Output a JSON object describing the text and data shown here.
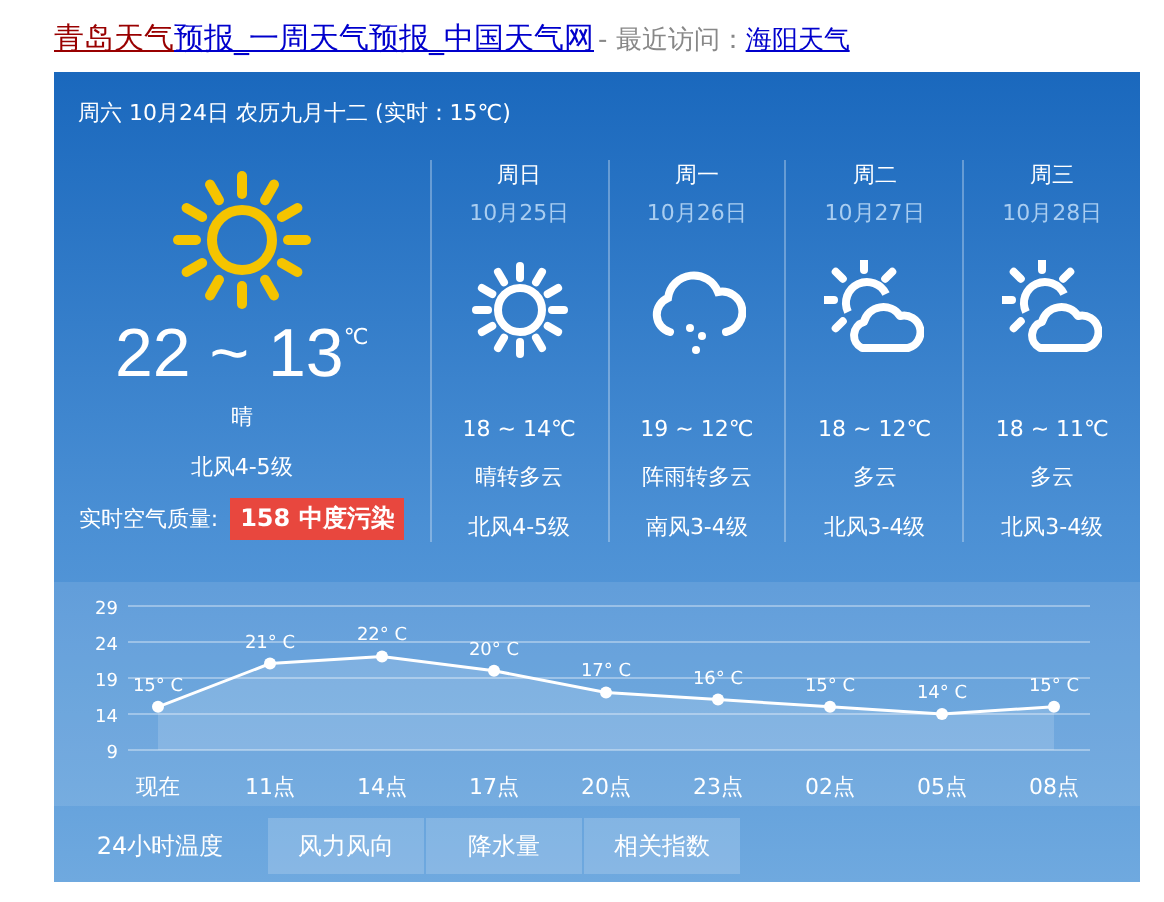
{
  "page_title": {
    "links": [
      {
        "text": "青岛天气",
        "visited": true
      },
      {
        "text": "预报_一周天气预报_中国天气网",
        "visited": false
      }
    ],
    "recent_label": " - 最近访问：",
    "recent_link": "海阳天气"
  },
  "header": "周六 10月24日 农历九月十二 (实时：15℃)",
  "today": {
    "kind": "sunny",
    "temp": "22 ~ 13",
    "unit": "℃",
    "weather": "晴",
    "wind": "北风4-5级",
    "aqi_label": "实时空气质量:",
    "aqi_badge": "158 中度污染"
  },
  "days": [
    {
      "weekday": "周日",
      "date": "10月25日",
      "kind": "sunny",
      "temp": "18 ~ 14℃",
      "weather": "晴转多云",
      "wind": "北风4-5级"
    },
    {
      "weekday": "周一",
      "date": "10月26日",
      "kind": "shower",
      "temp": "19 ~ 12℃",
      "weather": "阵雨转多云",
      "wind": "南风3-4级"
    },
    {
      "weekday": "周二",
      "date": "10月27日",
      "kind": "partly_cloudy",
      "temp": "18 ~ 12℃",
      "weather": "多云",
      "wind": "北风3-4级"
    },
    {
      "weekday": "周三",
      "date": "10月28日",
      "kind": "partly_cloudy",
      "temp": "18 ~ 11℃",
      "weather": "多云",
      "wind": "北风3-4级"
    }
  ],
  "chart": {
    "chart_data": {
      "type": "area",
      "categories": [
        "现在",
        "11点",
        "14点",
        "17点",
        "20点",
        "23点",
        "02点",
        "05点",
        "08点"
      ],
      "values": [
        15,
        21,
        22,
        20,
        17,
        16,
        15,
        14,
        15
      ],
      "value_labels": [
        "15° C",
        "21° C",
        "22° C",
        "20° C",
        "17° C",
        "16° C",
        "15° C",
        "14° C",
        "15° C"
      ],
      "ylim": [
        9,
        29
      ],
      "yticks": [
        9,
        14,
        19,
        24,
        29
      ],
      "grid": true
    }
  },
  "tabs": [
    {
      "label": "24小时温度",
      "selected": true
    },
    {
      "label": "风力风向",
      "selected": false
    },
    {
      "label": "降水量",
      "selected": false
    },
    {
      "label": "相关指数",
      "selected": false
    }
  ]
}
